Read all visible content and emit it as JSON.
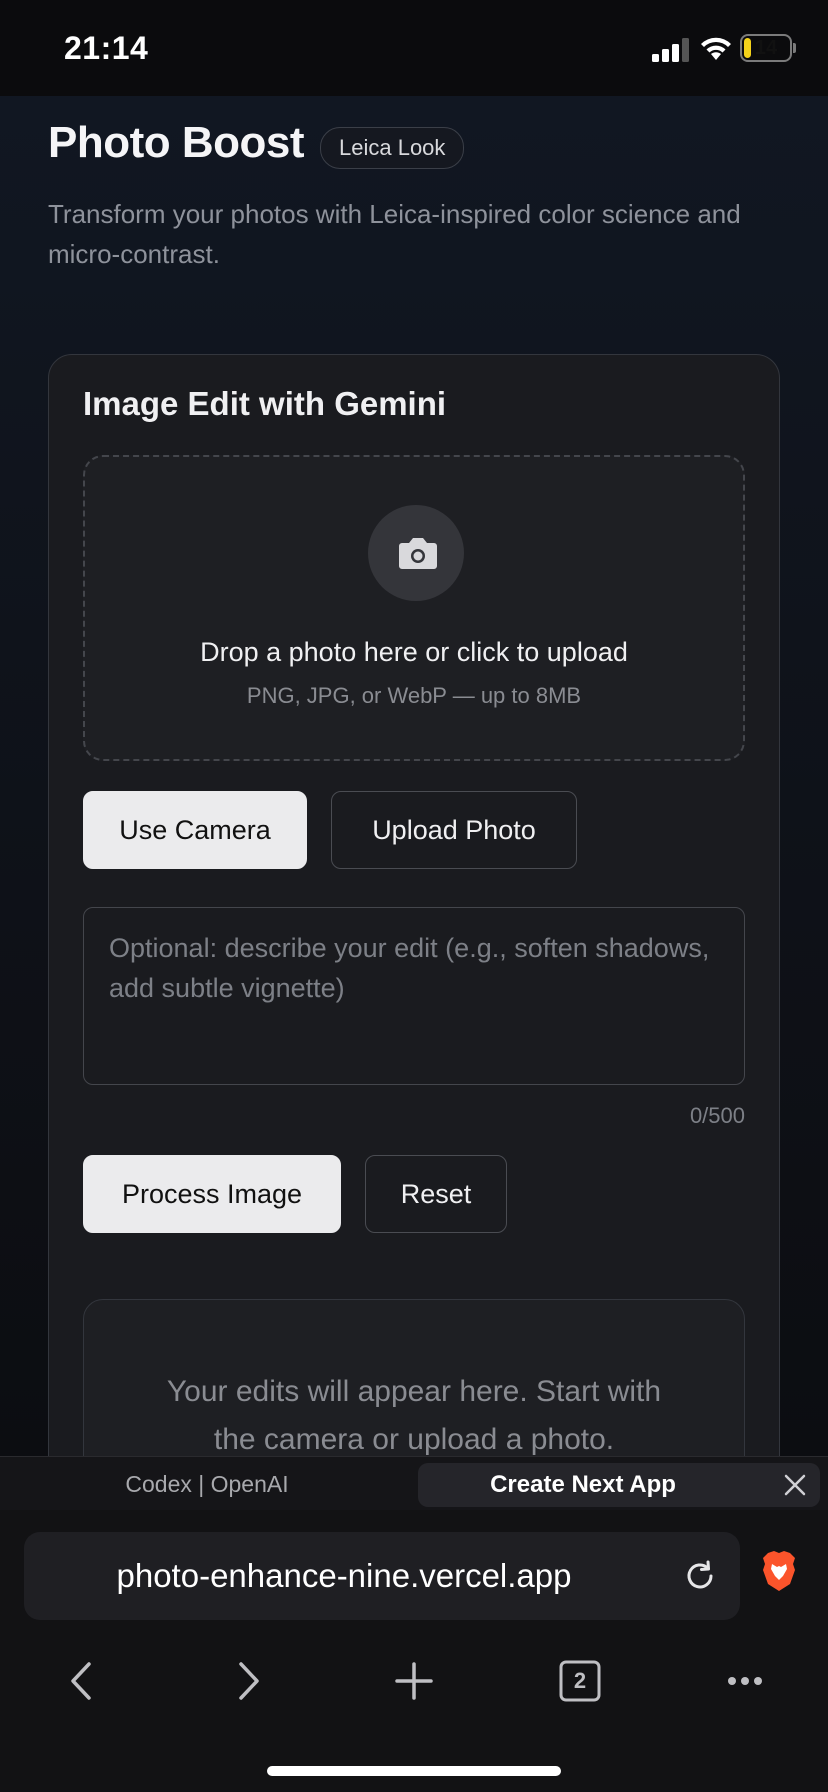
{
  "status_bar": {
    "time": "21:14",
    "battery": "14"
  },
  "header": {
    "title": "Photo Boost",
    "badge": "Leica Look",
    "subtitle": "Transform your photos with Leica-inspired color science and micro-contrast."
  },
  "card": {
    "title": "Image Edit with Gemini",
    "dropzone": {
      "title": "Drop a photo here or click to upload",
      "subtitle": "PNG, JPG, or WebP — up to 8MB"
    },
    "use_camera_label": "Use Camera",
    "upload_photo_label": "Upload Photo",
    "prompt": {
      "placeholder": "Optional: describe your edit (e.g., soften shadows, add subtle vignette)",
      "value": "",
      "counter": "0/500"
    },
    "process_label": "Process Image",
    "reset_label": "Reset",
    "result_placeholder": "Your edits will appear here. Start with the camera or upload a photo."
  },
  "browser": {
    "tabs": [
      {
        "label": "Codex | OpenAI",
        "active": false
      },
      {
        "label": "Create Next App",
        "active": true
      }
    ],
    "url": "photo-enhance-nine.vercel.app",
    "tab_count": "2",
    "icons": [
      "back-icon",
      "forward-icon",
      "new-tab-icon",
      "tabs-icon",
      "more-icon",
      "reload-icon",
      "brave-icon",
      "close-icon",
      "camera-icon"
    ]
  },
  "colors": {
    "background": "#0c0d10",
    "card": "#1a1b1f",
    "button_light": "#ebebed",
    "battery": "#f4d21a",
    "brave": "#fb542b"
  }
}
